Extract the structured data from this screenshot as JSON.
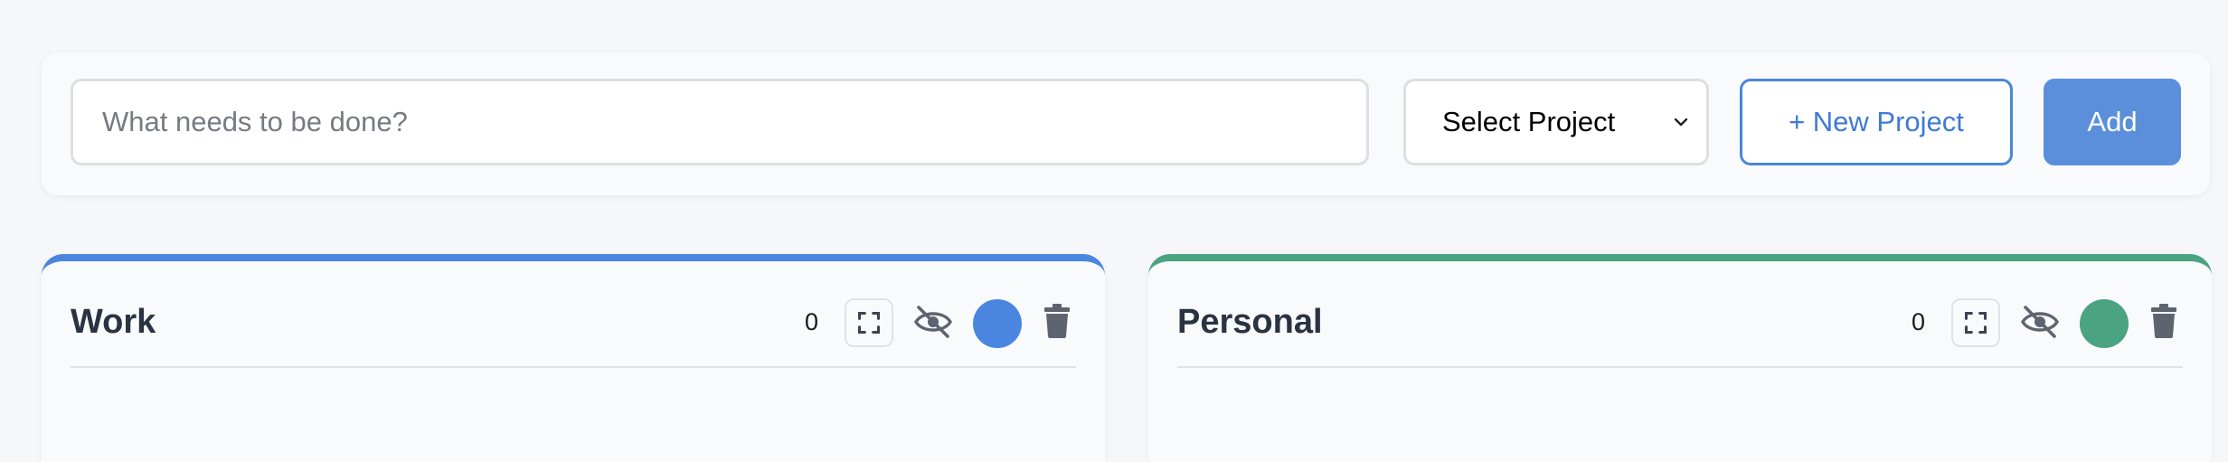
{
  "new_task": {
    "placeholder": "What needs to be done?",
    "project_select_value": "Select Project",
    "new_project_label": "+ New Project",
    "add_label": "Add"
  },
  "projects": [
    {
      "name": "Work",
      "count": "0",
      "color": "#4a86e0"
    },
    {
      "name": "Personal",
      "count": "0",
      "color": "#4aa381"
    }
  ]
}
